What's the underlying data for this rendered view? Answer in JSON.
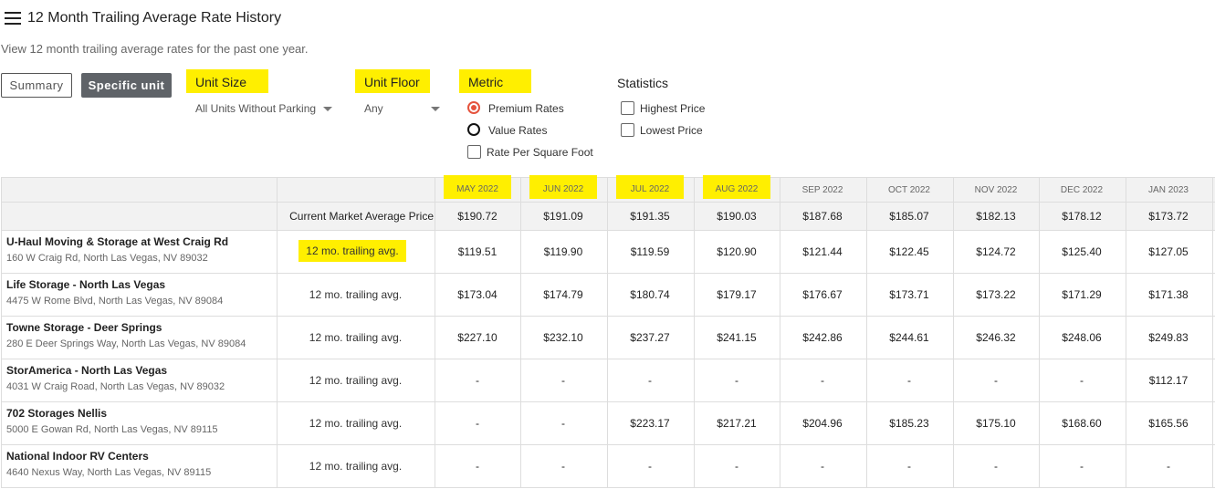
{
  "header": {
    "title": "12 Month Trailing Average Rate History",
    "subtitle": "View 12 month trailing average rates for the past one year."
  },
  "toolbar": {
    "summary_label": "Summary",
    "specific_unit_label": "Specific unit"
  },
  "filters": {
    "unit_size": {
      "label": "Unit Size",
      "value": "All Units Without Parking"
    },
    "unit_floor": {
      "label": "Unit Floor",
      "value": "Any"
    },
    "metric": {
      "label": "Metric",
      "options": [
        "Premium Rates",
        "Value Rates"
      ],
      "selected": "Premium Rates",
      "checkbox_label": "Rate Per Square Foot"
    },
    "statistics": {
      "label": "Statistics",
      "options": [
        "Highest Price",
        "Lowest Price"
      ]
    }
  },
  "table": {
    "months": [
      "MAY 2022",
      "JUN 2022",
      "JUL 2022",
      "AUG 2022",
      "SEP 2022",
      "OCT 2022",
      "NOV 2022",
      "DEC 2022",
      "JAN 2023"
    ],
    "market_label": "Current Market Average Price",
    "market_values": [
      "$190.72",
      "$191.09",
      "$191.35",
      "$190.03",
      "$187.68",
      "$185.07",
      "$182.13",
      "$178.12",
      "$173.72"
    ],
    "rows": [
      {
        "name": "U-Haul Moving & Storage at West Craig Rd",
        "address": "160 W Craig Rd, North Las Vegas, NV 89032",
        "metric": "12 mo. trailing avg.",
        "values": [
          "$119.51",
          "$119.90",
          "$119.59",
          "$120.90",
          "$121.44",
          "$122.45",
          "$124.72",
          "$125.40",
          "$127.05"
        ]
      },
      {
        "name": "Life Storage - North Las Vegas",
        "address": "4475 W Rome Blvd, North Las Vegas, NV 89084",
        "metric": "12 mo. trailing avg.",
        "values": [
          "$173.04",
          "$174.79",
          "$180.74",
          "$179.17",
          "$176.67",
          "$173.71",
          "$173.22",
          "$171.29",
          "$171.38"
        ]
      },
      {
        "name": "Towne Storage - Deer Springs",
        "address": "280 E Deer Springs Way, North Las Vegas, NV 89084",
        "metric": "12 mo. trailing avg.",
        "values": [
          "$227.10",
          "$232.10",
          "$237.27",
          "$241.15",
          "$242.86",
          "$244.61",
          "$246.32",
          "$248.06",
          "$249.83"
        ]
      },
      {
        "name": "StorAmerica - North Las Vegas",
        "address": "4031 W Craig Road, North Las Vegas, NV 89032",
        "metric": "12 mo. trailing avg.",
        "values": [
          "-",
          "-",
          "-",
          "-",
          "-",
          "-",
          "-",
          "-",
          "$112.17"
        ]
      },
      {
        "name": "702 Storages Nellis",
        "address": "5000 E Gowan Rd, North Las Vegas, NV 89115",
        "metric": "12 mo. trailing avg.",
        "values": [
          "-",
          "-",
          "$223.17",
          "$217.21",
          "$204.96",
          "$185.23",
          "$175.10",
          "$168.60",
          "$165.56"
        ]
      },
      {
        "name": "National Indoor RV Centers",
        "address": "4640 Nexus Way, North Las Vegas, NV 89115",
        "metric": "12 mo. trailing avg.",
        "values": [
          "-",
          "-",
          "-",
          "-",
          "-",
          "-",
          "-",
          "-",
          "-"
        ]
      }
    ]
  },
  "colors": {
    "highlight": "#ffef00",
    "radio_selected": "#e5533d",
    "button_dark": "#5f6368"
  },
  "icons": {
    "menu": "hamburger-menu-icon",
    "dropdown": "caret-down-icon"
  }
}
